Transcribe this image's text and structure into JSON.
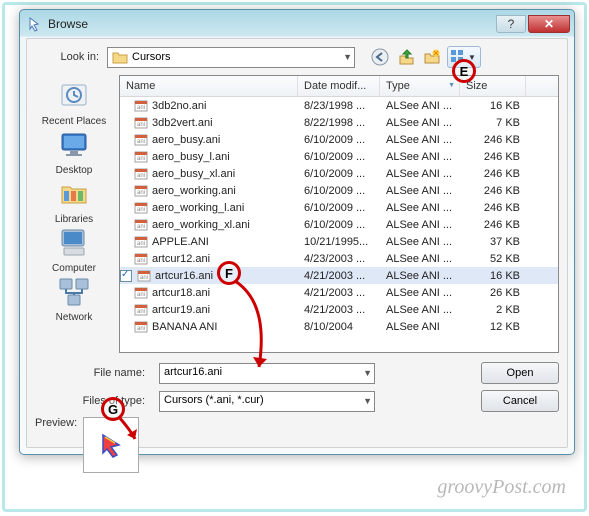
{
  "window": {
    "title": "Browse"
  },
  "lookin": {
    "label": "Look in:",
    "folder": "Cursors"
  },
  "columns": {
    "name": "Name",
    "date": "Date modif...",
    "type": "Type",
    "size": "Size"
  },
  "places": [
    {
      "label": "Recent Places",
      "kind": "recent"
    },
    {
      "label": "Desktop",
      "kind": "desktop"
    },
    {
      "label": "Libraries",
      "kind": "libraries"
    },
    {
      "label": "Computer",
      "kind": "computer"
    },
    {
      "label": "Network",
      "kind": "network"
    }
  ],
  "files": [
    {
      "name": "3db2no.ani",
      "date": "8/23/1998 ...",
      "type": "ALSee ANI ...",
      "size": "16 KB"
    },
    {
      "name": "3db2vert.ani",
      "date": "8/22/1998 ...",
      "type": "ALSee ANI ...",
      "size": "7 KB"
    },
    {
      "name": "aero_busy.ani",
      "date": "6/10/2009 ...",
      "type": "ALSee ANI ...",
      "size": "246 KB"
    },
    {
      "name": "aero_busy_l.ani",
      "date": "6/10/2009 ...",
      "type": "ALSee ANI ...",
      "size": "246 KB"
    },
    {
      "name": "aero_busy_xl.ani",
      "date": "6/10/2009 ...",
      "type": "ALSee ANI ...",
      "size": "246 KB"
    },
    {
      "name": "aero_working.ani",
      "date": "6/10/2009 ...",
      "type": "ALSee ANI ...",
      "size": "246 KB"
    },
    {
      "name": "aero_working_l.ani",
      "date": "6/10/2009 ...",
      "type": "ALSee ANI ...",
      "size": "246 KB"
    },
    {
      "name": "aero_working_xl.ani",
      "date": "6/10/2009 ...",
      "type": "ALSee ANI ...",
      "size": "246 KB"
    },
    {
      "name": "APPLE.ANI",
      "date": "10/21/1995...",
      "type": "ALSee ANI ...",
      "size": "37 KB"
    },
    {
      "name": "artcur12.ani",
      "date": "4/23/2003 ...",
      "type": "ALSee ANI ...",
      "size": "52 KB"
    },
    {
      "name": "artcur16.ani",
      "date": "4/21/2003 ...",
      "type": "ALSee ANI ...",
      "size": "16 KB",
      "selected": true
    },
    {
      "name": "artcur18.ani",
      "date": "4/21/2003 ...",
      "type": "ALSee ANI ...",
      "size": "26 KB"
    },
    {
      "name": "artcur19.ani",
      "date": "4/21/2003 ...",
      "type": "ALSee ANI ...",
      "size": "2 KB"
    },
    {
      "name": "BANANA ANI",
      "date": "8/10/2004",
      "type": "ALSee ANI",
      "size": "12 KB"
    }
  ],
  "filename": {
    "label": "File name:",
    "value": "artcur16.ani"
  },
  "filetype": {
    "label": "Files of type:",
    "value": "Cursors (*.ani, *.cur)"
  },
  "buttons": {
    "open": "Open",
    "cancel": "Cancel"
  },
  "preview": {
    "label": "Preview:"
  },
  "annotations": {
    "e": "E",
    "f": "F",
    "g": "G"
  },
  "watermark": "groovyPost.com"
}
